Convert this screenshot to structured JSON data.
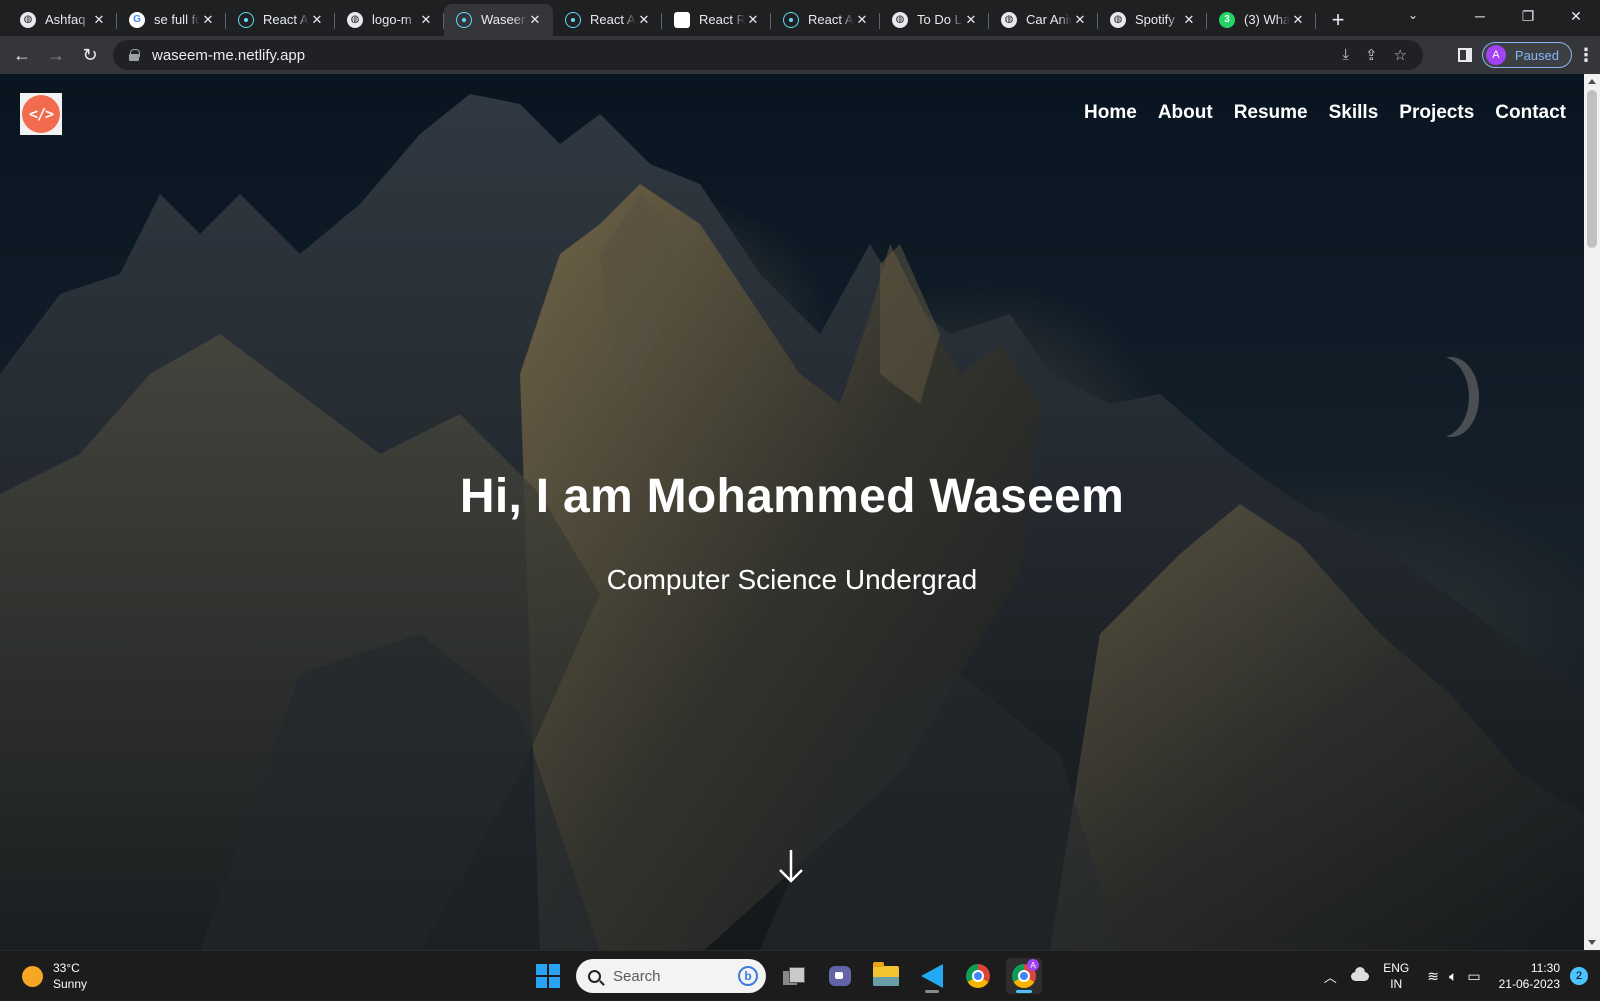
{
  "browser": {
    "tabs": [
      {
        "title": "Ashfaq",
        "favicon": "globe-icon",
        "active": false
      },
      {
        "title": "se full fo",
        "favicon": "google-icon",
        "active": false
      },
      {
        "title": "React A",
        "favicon": "react-icon",
        "active": false
      },
      {
        "title": "logo-m",
        "favicon": "globe-icon",
        "active": false
      },
      {
        "title": "Waseem",
        "favicon": "react-icon",
        "active": true
      },
      {
        "title": "React A",
        "favicon": "react-icon",
        "active": false
      },
      {
        "title": "React R",
        "favicon": "react-router-icon",
        "active": false
      },
      {
        "title": "React A",
        "favicon": "react-icon",
        "active": false
      },
      {
        "title": "To Do L",
        "favicon": "globe-icon",
        "active": false
      },
      {
        "title": "Car Anim",
        "favicon": "globe-icon",
        "active": false
      },
      {
        "title": "Spotify",
        "favicon": "globe-icon",
        "active": false
      },
      {
        "title": "(3) Wha",
        "favicon": "whatsapp-icon",
        "active": false,
        "badge": "3"
      }
    ],
    "new_tab_symbol": "+",
    "url": "waseem-me.netlify.app",
    "profile": {
      "initial": "A",
      "status": "Paused"
    }
  },
  "page": {
    "logo_text": "</>",
    "nav": [
      "Home",
      "About",
      "Resume",
      "Skills",
      "Projects",
      "Contact"
    ],
    "hero_title": "Hi, I am Mohammed Waseem",
    "hero_subtitle": "Computer Science Undergrad",
    "accent_color": "#f26b4f"
  },
  "taskbar": {
    "weather": {
      "temp": "33°C",
      "condition": "Sunny"
    },
    "search_placeholder": "Search",
    "lang": {
      "line1": "ENG",
      "line2": "IN"
    },
    "time": "11:30",
    "date": "21-06-2023",
    "notifications": "2",
    "chrome_badge": "A"
  }
}
